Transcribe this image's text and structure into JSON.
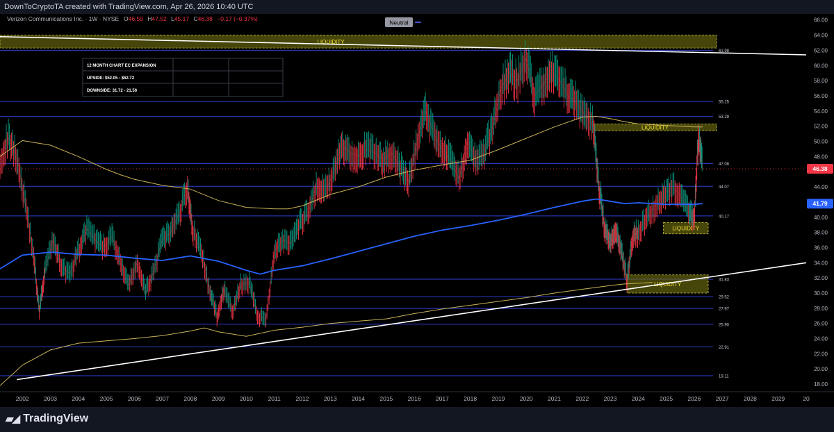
{
  "header": {
    "caption": "DownToCryptoTA created with TradingView.com, Apr 26, 2026 10:40 UTC",
    "symbol_line": "Verizon Communications Inc. · 1W · NYSE",
    "ohlc": {
      "o_label": "O",
      "o": "46.59",
      "h_label": "H",
      "h": "47.52",
      "l_label": "L",
      "l": "45.17",
      "c_label": "C",
      "c": "46.38",
      "change": "−0.17 (−0.37%)"
    },
    "indicator_badge": "Neutral"
  },
  "info_table": {
    "rows": [
      "12 MONTH CHART EC EXPANSION",
      "UPSIDE: $52.05 - $62.72",
      "DOWNSIDE: 31.72 - 21.56"
    ]
  },
  "footer": {
    "logo_text": "TradingView"
  },
  "chart_data": {
    "type": "line",
    "title": "Verizon Communications Inc. · 1W · NYSE",
    "x_ticks": [
      "2002",
      "2003",
      "2004",
      "2005",
      "2006",
      "2007",
      "2008",
      "2009",
      "2010",
      "2011",
      "2012",
      "2013",
      "2014",
      "2015",
      "2016",
      "2017",
      "2018",
      "2019",
      "2020",
      "2021",
      "2022",
      "2023",
      "2024",
      "2025",
      "2026",
      "2027",
      "2028",
      "2029",
      "20"
    ],
    "x_range": [
      2001.2,
      2030.0
    ],
    "ylim": [
      17.0,
      66.8
    ],
    "y_ticks": [
      "66.00",
      "64.00",
      "62.00",
      "60.00",
      "58.00",
      "56.00",
      "54.00",
      "52.00",
      "50.00",
      "48.00",
      "46.00",
      "44.00",
      "42.00",
      "40.00",
      "38.00",
      "36.00",
      "34.00",
      "32.00",
      "30.00",
      "28.00",
      "26.00",
      "24.00",
      "22.00",
      "20.00",
      "18.00"
    ],
    "y_axis_side": "right",
    "grid": false,
    "price_labels": [
      {
        "value": 46.38,
        "text": "46.38",
        "color": "#f23645"
      },
      {
        "value": 41.79,
        "text": "41.79",
        "color": "#2962ff"
      }
    ],
    "horizontal_levels": [
      {
        "value": 61.98,
        "label": "61.98"
      },
      {
        "value": 55.25,
        "label": "55.25"
      },
      {
        "value": 53.29,
        "label": "53.29"
      },
      {
        "value": 47.08,
        "label": "47.08"
      },
      {
        "value": 44.07,
        "label": "44.07"
      },
      {
        "value": 40.17,
        "label": "40.17"
      },
      {
        "value": 31.83,
        "label": "31.83"
      },
      {
        "value": 29.52,
        "label": "29.52"
      },
      {
        "value": 27.97,
        "label": "27.97"
      },
      {
        "value": 25.9,
        "label": "25.90"
      },
      {
        "value": 22.91,
        "label": "22.91"
      },
      {
        "value": 19.11,
        "label": "19.11"
      }
    ],
    "current_price_line": 46.38,
    "liquidity_zones": [
      {
        "x0": 2001.2,
        "x1": 2026.8,
        "y0": 62.3,
        "y1": 64.0,
        "label": "LIQUIDITY"
      },
      {
        "x0": 2022.4,
        "x1": 2026.8,
        "y0": 51.4,
        "y1": 52.3,
        "label": "LIQUIDITY"
      },
      {
        "x0": 2024.9,
        "x1": 2026.5,
        "y0": 37.8,
        "y1": 39.3,
        "label": "LIQUIDITY"
      },
      {
        "x0": 2023.6,
        "x1": 2026.5,
        "y0": 30.0,
        "y1": 32.4,
        "label": "LIQUIDITY"
      }
    ],
    "trendlines": [
      {
        "name": "",
        "x": [
          2001.2,
          2030.0
        ],
        "y": [
          63.8,
          61.4
        ],
        "color": "#ffffff"
      },
      {
        "name": "",
        "x": [
          2001.8,
          2030.0
        ],
        "y": [
          18.6,
          34.0
        ],
        "color": "#ffffff"
      }
    ],
    "series": [
      {
        "name": "",
        "kind": "price",
        "color": "#089981",
        "x": [
          2001.2,
          2001.5,
          2001.8,
          2002.1,
          2002.4,
          2002.6,
          2002.8,
          2003.1,
          2003.4,
          2003.7,
          2004.0,
          2004.3,
          2004.6,
          2004.9,
          2005.2,
          2005.5,
          2005.8,
          2006.1,
          2006.4,
          2006.7,
          2007.0,
          2007.3,
          2007.6,
          2007.9,
          2008.1,
          2008.4,
          2008.7,
          2008.95,
          2009.2,
          2009.5,
          2009.8,
          2010.1,
          2010.4,
          2010.7,
          2011.0,
          2011.3,
          2011.6,
          2011.9,
          2012.2,
          2012.5,
          2012.8,
          2013.1,
          2013.4,
          2013.7,
          2014.0,
          2014.3,
          2014.6,
          2014.9,
          2015.2,
          2015.5,
          2015.8,
          2016.1,
          2016.4,
          2016.7,
          2017.0,
          2017.3,
          2017.6,
          2017.9,
          2018.2,
          2018.5,
          2018.8,
          2019.1,
          2019.4,
          2019.7,
          2020.0,
          2020.3,
          2020.6,
          2020.9,
          2021.2,
          2021.5,
          2021.8,
          2022.1,
          2022.4,
          2022.6,
          2022.8,
          2023.0,
          2023.2,
          2023.4,
          2023.6,
          2023.8,
          2024.0,
          2024.3,
          2024.6,
          2024.9,
          2025.2,
          2025.5,
          2025.8,
          2026.0,
          2026.15,
          2026.3
        ],
        "y": [
          47.5,
          50.5,
          48.0,
          42.0,
          35.0,
          27.5,
          33.0,
          37.0,
          33.5,
          32.5,
          35.5,
          38.5,
          37.0,
          36.0,
          37.5,
          34.0,
          31.0,
          34.0,
          30.0,
          33.0,
          37.0,
          38.0,
          40.5,
          44.0,
          38.0,
          35.5,
          30.0,
          27.0,
          30.5,
          27.5,
          31.0,
          31.5,
          27.0,
          26.5,
          35.5,
          37.0,
          36.5,
          39.0,
          40.5,
          44.0,
          43.5,
          45.5,
          49.5,
          48.5,
          48.0,
          49.0,
          48.5,
          47.5,
          48.5,
          46.5,
          44.5,
          50.0,
          54.0,
          51.0,
          49.0,
          47.5,
          45.0,
          50.0,
          47.5,
          48.5,
          52.0,
          57.0,
          59.0,
          58.0,
          61.0,
          56.0,
          57.5,
          59.0,
          58.0,
          56.0,
          55.0,
          53.5,
          52.0,
          44.0,
          38.5,
          36.5,
          38.5,
          35.5,
          31.5,
          37.5,
          38.0,
          40.0,
          41.5,
          43.0,
          44.0,
          43.0,
          40.5,
          40.0,
          50.5,
          46.4
        ]
      },
      {
        "name": "",
        "kind": "blue_ma",
        "color": "#2962ff",
        "x": [
          2001.2,
          2002.0,
          2003.0,
          2004.0,
          2005.0,
          2006.0,
          2007.0,
          2008.0,
          2009.0,
          2010.0,
          2010.5,
          2011.0,
          2012.0,
          2013.0,
          2014.0,
          2015.0,
          2016.0,
          2017.0,
          2018.0,
          2019.0,
          2020.0,
          2021.0,
          2022.0,
          2022.5,
          2023.0,
          2023.5,
          2024.0,
          2025.0,
          2026.0,
          2026.3
        ],
        "y": [
          33.2,
          35.0,
          35.4,
          35.1,
          35.0,
          34.6,
          34.3,
          34.9,
          34.2,
          33.0,
          32.5,
          33.0,
          33.6,
          34.5,
          35.5,
          36.5,
          37.5,
          38.3,
          38.9,
          39.6,
          40.4,
          41.3,
          42.1,
          42.4,
          42.1,
          41.8,
          41.9,
          41.7,
          41.7,
          41.8
        ]
      },
      {
        "name": "",
        "kind": "yellow_ma",
        "color": "#c9b458",
        "x": [
          2001.2,
          2002.0,
          2003.0,
          2004.0,
          2005.0,
          2005.5,
          2006.0,
          2007.0,
          2008.0,
          2009.0,
          2010.0,
          2011.0,
          2011.5,
          2012.0,
          2013.0,
          2014.0,
          2015.0,
          2016.0,
          2017.0,
          2018.0,
          2019.0,
          2020.0,
          2021.0,
          2022.0,
          2022.5,
          2023.0,
          2023.5,
          2024.0,
          2025.0,
          2026.0,
          2026.3
        ],
        "y": [
          48.0,
          50.1,
          49.5,
          48.0,
          46.3,
          45.6,
          45.0,
          44.2,
          43.7,
          42.2,
          41.3,
          41.1,
          41.1,
          41.5,
          43.0,
          44.0,
          45.3,
          46.2,
          46.9,
          47.5,
          48.9,
          50.4,
          51.9,
          53.2,
          53.3,
          53.0,
          52.6,
          52.3,
          52.1,
          51.9,
          51.9
        ]
      },
      {
        "name": "",
        "kind": "yellow_long_ma",
        "color": "#c9b458",
        "x": [
          2001.2,
          2002.0,
          2003.0,
          2004.0,
          2005.0,
          2006.0,
          2007.0,
          2008.0,
          2008.5,
          2009.0,
          2010.0,
          2011.0,
          2012.0,
          2013.0,
          2014.0,
          2015.0,
          2016.0,
          2017.0,
          2018.0,
          2019.0,
          2020.0,
          2021.0,
          2022.0,
          2023.0,
          2023.5,
          2024.0,
          2024.5
        ],
        "y": [
          17.8,
          20.5,
          22.5,
          23.4,
          23.7,
          24.0,
          24.4,
          25.0,
          25.4,
          24.9,
          24.3,
          25.1,
          25.5,
          26.0,
          26.3,
          26.6,
          27.3,
          27.9,
          28.4,
          28.9,
          29.4,
          30.0,
          30.5,
          31.0,
          31.2,
          31.3,
          31.4
        ]
      }
    ]
  }
}
